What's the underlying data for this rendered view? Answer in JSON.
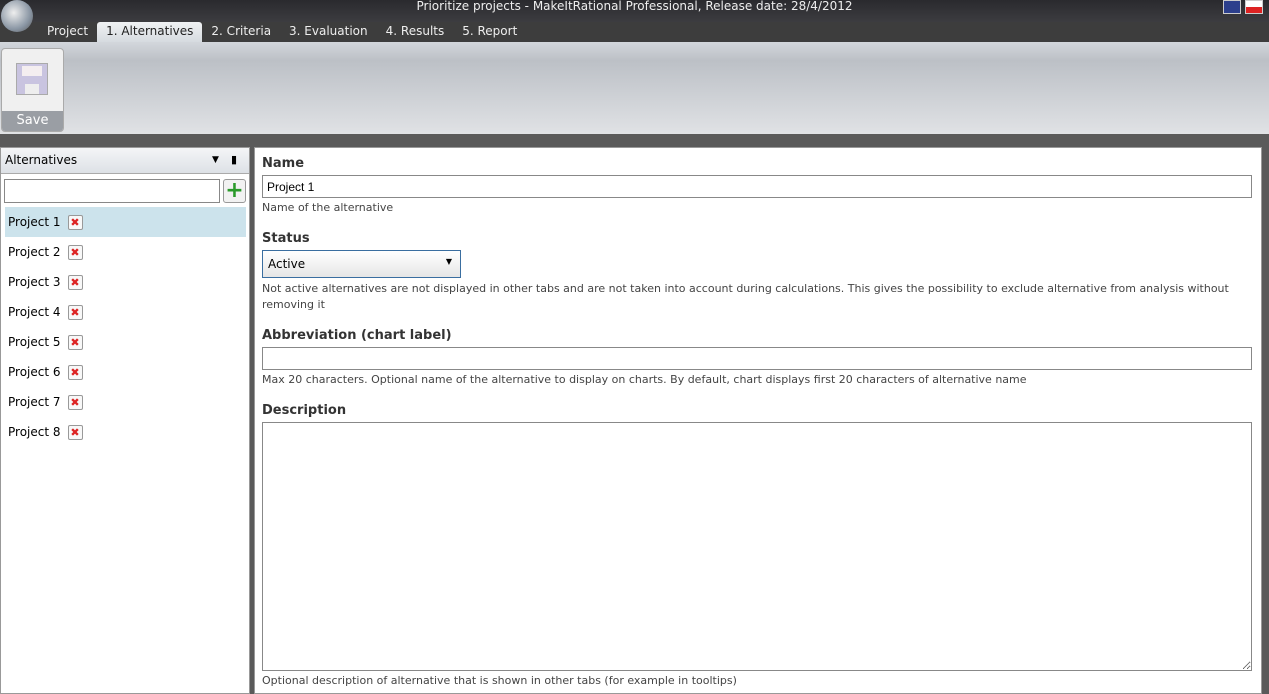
{
  "window": {
    "title": "Prioritize projects - MakeItRational Professional, Release date: 28/4/2012"
  },
  "tabs": [
    {
      "label": "Project"
    },
    {
      "label": "1. Alternatives"
    },
    {
      "label": "2. Criteria"
    },
    {
      "label": "3. Evaluation"
    },
    {
      "label": "4. Results"
    },
    {
      "label": "5. Report"
    }
  ],
  "ribbon": {
    "save_label": "Save"
  },
  "left": {
    "title": "Alternatives",
    "search_value": "",
    "items": [
      {
        "label": "Project 1"
      },
      {
        "label": "Project 2"
      },
      {
        "label": "Project 3"
      },
      {
        "label": "Project 4"
      },
      {
        "label": "Project 5"
      },
      {
        "label": "Project 6"
      },
      {
        "label": "Project 7"
      },
      {
        "label": "Project 8"
      }
    ]
  },
  "form": {
    "name_label": "Name",
    "name_value": "Project 1",
    "name_hint": "Name of the alternative",
    "status_label": "Status",
    "status_value": "Active",
    "status_hint": "Not active alternatives are not displayed in other tabs and are not taken into account during calculations. This gives the possibility to exclude alternative from analysis without removing it",
    "abbr_label": "Abbreviation (chart label)",
    "abbr_value": "",
    "abbr_hint": "Max 20 characters. Optional name of the alternative to display on charts. By default, chart displays first 20 characters of alternative name",
    "desc_label": "Description",
    "desc_value": "",
    "desc_hint": "Optional description of alternative that is shown in other tabs (for example in tooltips)"
  }
}
